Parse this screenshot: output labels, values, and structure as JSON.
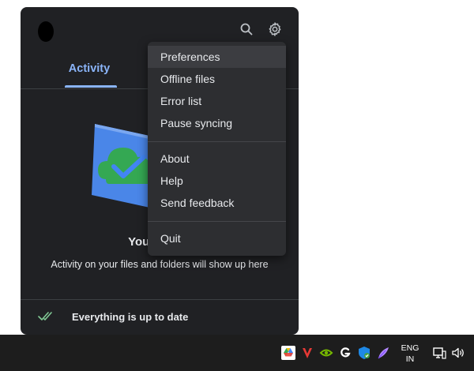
{
  "panel": {
    "tabs": [
      {
        "label": "Activity",
        "active": true
      }
    ],
    "empty_state": {
      "title": "Your files a",
      "subtitle": "Activity on your files and folders will show up here"
    },
    "status": {
      "text": "Everything is up to date"
    }
  },
  "menu": {
    "group1": [
      {
        "label": "Preferences",
        "highlighted": true
      },
      {
        "label": "Offline files"
      },
      {
        "label": "Error list"
      },
      {
        "label": "Pause syncing"
      }
    ],
    "group2": [
      {
        "label": "About"
      },
      {
        "label": "Help"
      },
      {
        "label": "Send feedback"
      }
    ],
    "group3": [
      {
        "label": "Quit"
      }
    ]
  },
  "taskbar": {
    "tray_icons": [
      "google-drive-icon",
      "vivaldi-icon",
      "nvidia-icon",
      "logitech-g-icon",
      "windows-security-icon",
      "feather-icon"
    ],
    "language_line1": "ENG",
    "language_line2": "IN",
    "system_icons": [
      "network-icon",
      "speaker-icon"
    ]
  },
  "colors": {
    "panel_bg": "#202124",
    "menu_bg": "#2d2e31",
    "accent": "#8ab4f8",
    "taskbar_bg": "#1d1d1d"
  }
}
